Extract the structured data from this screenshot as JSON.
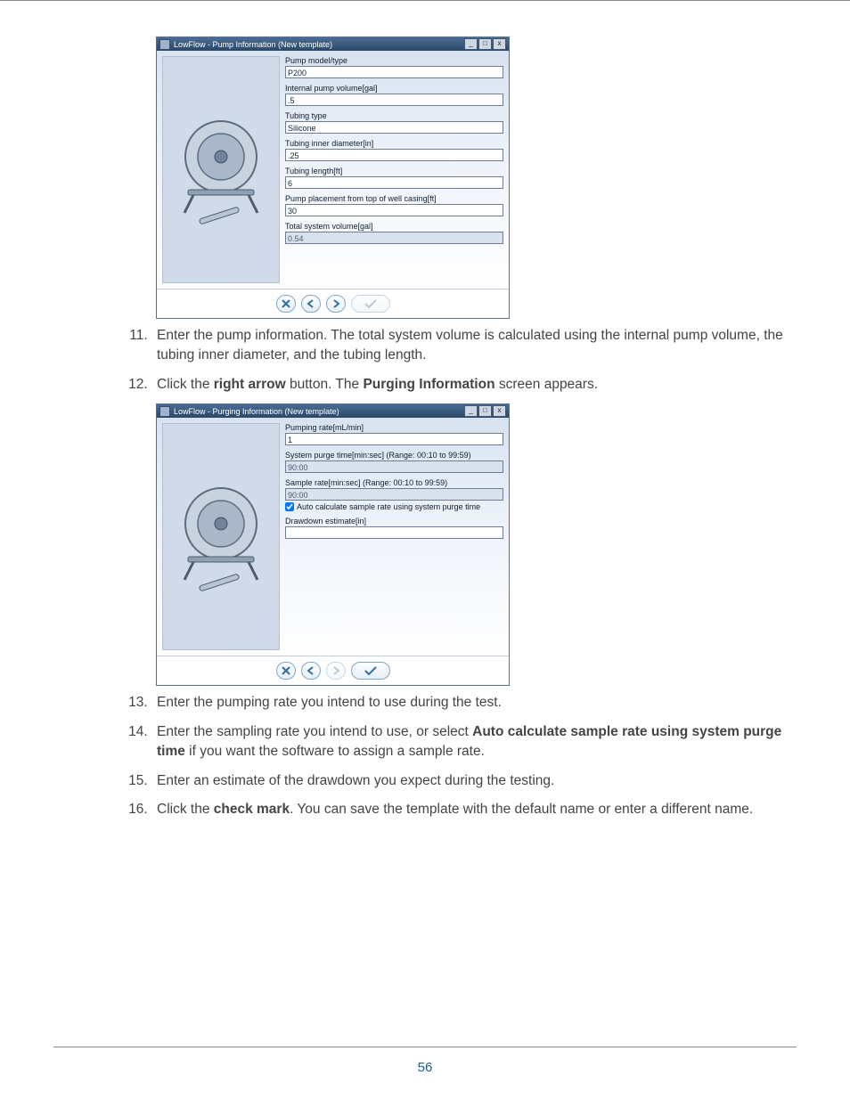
{
  "page_number": "56",
  "window1": {
    "title": "LowFlow - Pump Information (New template)",
    "fields": {
      "pump_model": {
        "label": "Pump model/type",
        "value": "P200"
      },
      "internal_volume": {
        "label": "Internal pump volume[gal]",
        "value": ".5"
      },
      "tubing_type": {
        "label": "Tubing type",
        "value": "Silicone"
      },
      "tubing_id": {
        "label": "Tubing inner diameter[in]",
        "value": ".25"
      },
      "tubing_length": {
        "label": "Tubing length[ft]",
        "value": "6"
      },
      "pump_placement": {
        "label": "Pump placement from top of well casing[ft]",
        "value": "30"
      },
      "total_volume": {
        "label": "Total system volume[gal]",
        "value": "0.54"
      }
    }
  },
  "window2": {
    "title": "LowFlow - Purging Information (New template)",
    "fields": {
      "pumping_rate": {
        "label": "Pumping rate[mL/min]",
        "value": "1"
      },
      "purge_time": {
        "label": "System purge time[min:sec] (Range: 00:10 to 99:59)",
        "value": "90:00"
      },
      "sample_rate": {
        "label": "Sample rate[min:sec] (Range: 00:10 to 99:59)",
        "value": "90:00"
      },
      "auto_calc": {
        "label": "Auto calculate sample rate using system purge time"
      },
      "drawdown": {
        "label": "Drawdown estimate[in]",
        "value": ""
      }
    }
  },
  "window_controls": {
    "min": "_",
    "max": "□",
    "close": "x"
  },
  "steps": {
    "s11": {
      "num": "11.",
      "text": "Enter the pump information. The total system volume is calculated using the internal pump volume, the tubing inner diameter, and the tubing length."
    },
    "s12": {
      "num": "12.",
      "prefix": "Click the ",
      "b1": "right arrow",
      "mid": " button. The ",
      "b2": "Purging Information",
      "suffix": " screen appears."
    },
    "s13": {
      "num": "13.",
      "text": "Enter the pumping rate you intend to use during the test."
    },
    "s14": {
      "num": "14.",
      "prefix": "Enter the sampling rate you intend to use, or select ",
      "b1": "Auto calculate sample rate using system purge time",
      "suffix": " if you want the software to assign a sample rate."
    },
    "s15": {
      "num": "15.",
      "text": "Enter an estimate of the drawdown you expect during the testing."
    },
    "s16": {
      "num": "16.",
      "prefix": "Click the ",
      "b1": "check mark",
      "suffix": ". You can save the template with the default name or enter a different name."
    }
  }
}
